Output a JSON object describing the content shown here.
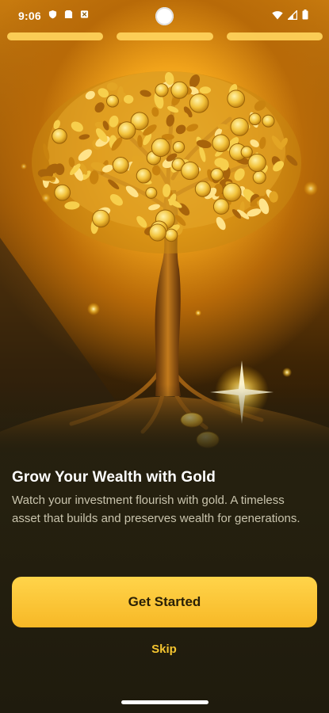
{
  "status_bar": {
    "time": "9:06",
    "left_icons": [
      "shield-icon",
      "sim-card-icon",
      "notification-icon"
    ],
    "right_icons": [
      "wifi-icon",
      "signal-icon",
      "battery-icon"
    ]
  },
  "onboarding": {
    "total_steps": 3,
    "current_step": 1,
    "hero_image": "golden tree with coins",
    "title": "Grow Your Wealth with Gold",
    "subtitle": "Watch your investment flourish with gold. A timeless asset that builds and preserves wealth for generations.",
    "primary_button": "Get Started",
    "skip_button": "Skip"
  },
  "colors": {
    "accent": "#f7b826",
    "accent_light": "#ffd44a",
    "skip_text": "#f4c430",
    "background": "#25200f"
  }
}
